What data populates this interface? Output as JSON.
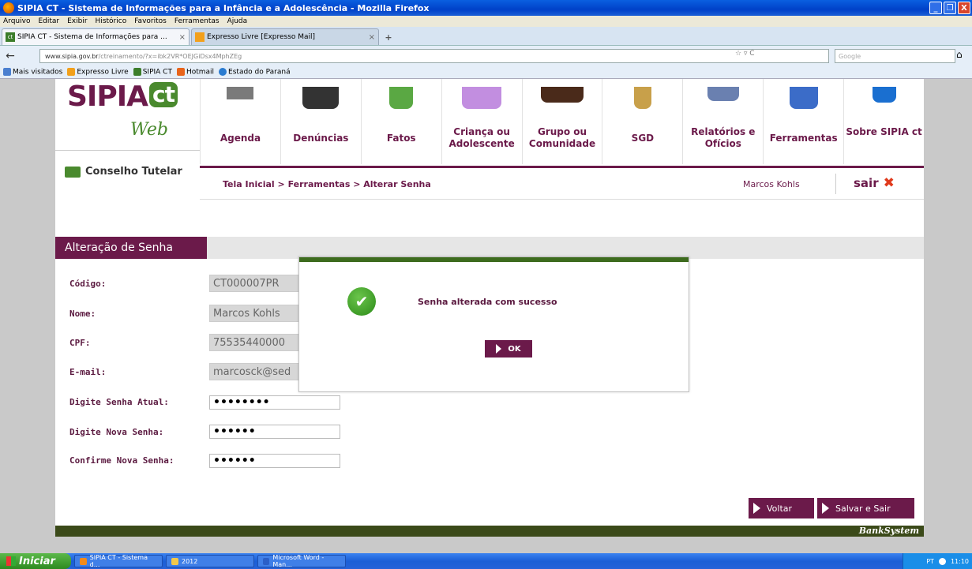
{
  "window": {
    "title": "SIPIA CT - Sistema de Informações para a Infância e a Adolescência - Mozilla Firefox",
    "buttons": [
      "_",
      "❐",
      "X"
    ]
  },
  "menubar": [
    "Arquivo",
    "Editar",
    "Exibir",
    "Histórico",
    "Favoritos",
    "Ferramentas",
    "Ajuda"
  ],
  "tabs": [
    {
      "title": "SIPIA CT - Sistema de Informações para ...",
      "close": "×"
    },
    {
      "title": "Expresso Livre [Expresso Mail]",
      "close": "×"
    }
  ],
  "newtab": "+",
  "nav": {
    "back": "←",
    "url_domain": "www.sipia.gov.br",
    "url_rest": "/ctreinamento/?x=ibk2VR*OEJGiDsx4MphZEg",
    "url_icons": "☆ ▿ C",
    "search_placeholder": "Google",
    "home": "⌂"
  },
  "bookmarks": [
    "Mais visitados",
    "Expresso Livre",
    "SIPIA CT",
    "Hotmail",
    "Estado do Paraná"
  ],
  "header": {
    "logo_main": "SIPIA",
    "logo_ct": "ct",
    "logo_web": "Web",
    "module": "Conselho Tutelar"
  },
  "menu": [
    {
      "label": "Agenda"
    },
    {
      "label": "Denúncias"
    },
    {
      "label": "Fatos"
    },
    {
      "label": "Criança ou Adolescente"
    },
    {
      "label": "Grupo ou Comunidade"
    },
    {
      "label": "SGD"
    },
    {
      "label": "Relatórios e Ofícios"
    },
    {
      "label": "Ferramentas"
    },
    {
      "label": "Sobre SIPIA ct"
    }
  ],
  "breadcrumb": "Tela Inicial > Ferramentas > Alterar Senha",
  "user": {
    "name": "Marcos Kohls",
    "logout": "sair",
    "logout_icon": "✖"
  },
  "section_title": "Alteração de Senha",
  "form": {
    "codigo_label": "Código:",
    "codigo_value": "CT000007PR",
    "nome_label": "Nome:",
    "nome_value": "Marcos Kohls",
    "cpf_label": "CPF:",
    "cpf_value": "75535440000",
    "email_label": "E-mail:",
    "email_value": "marcosck@sed",
    "senha_atual_label": "Digite Senha Atual:",
    "senha_atual_value": "••••••••",
    "nova_senha_label": "Digite Nova Senha:",
    "nova_senha_value": "••••••",
    "confirme_label": "Confirme Nova Senha:",
    "confirme_value": "••••••"
  },
  "buttons": {
    "voltar": "Voltar",
    "salvar": "Salvar e Sair"
  },
  "footer": "BankSystem",
  "modal": {
    "message": "Senha alterada com sucesso",
    "ok": "OK",
    "check": "✔"
  },
  "taskbar": {
    "start": "Iniciar",
    "tasks": [
      "SIPIA CT - Sistema d...",
      "2012",
      "Microsoft Word - Man..."
    ],
    "lang": "PT",
    "clock": "11:10"
  },
  "colors": {
    "brand": "#6b1a4a",
    "green": "#4a8a2e",
    "footer": "#3b4a19"
  }
}
